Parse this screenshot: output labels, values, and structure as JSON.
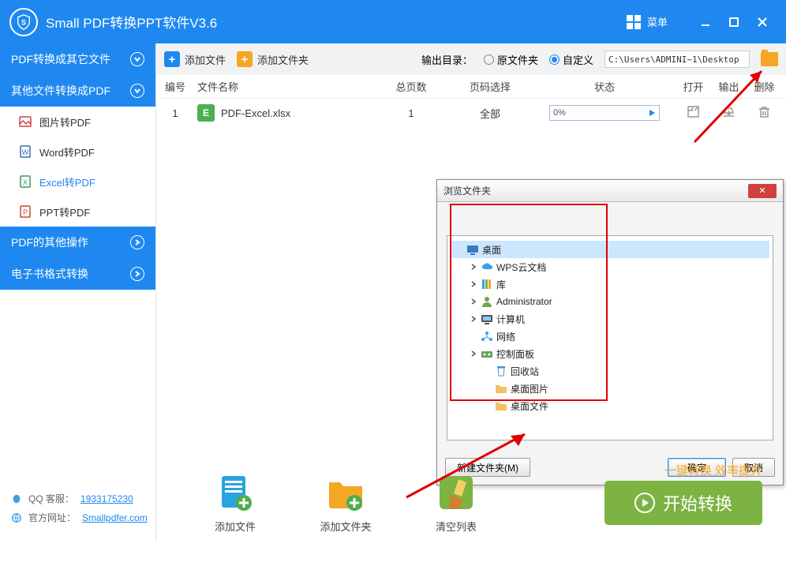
{
  "titlebar": {
    "title": "Small  PDF转换PPT软件V3.6",
    "menu": "菜单"
  },
  "sidebar": {
    "groups": [
      {
        "label": "PDF转换成其它文件"
      },
      {
        "label": "其他文件转换成PDF"
      }
    ],
    "items": [
      {
        "label": "图片转PDF"
      },
      {
        "label": "Word转PDF"
      },
      {
        "label": "Excel转PDF"
      },
      {
        "label": "PPT转PDF"
      }
    ],
    "groupsAfter": [
      {
        "label": "PDF的其他操作"
      },
      {
        "label": "电子书格式转换"
      }
    ],
    "footer": {
      "qq_label": "QQ 客服：",
      "qq_link": "1933175230",
      "site_label": "官方网址：",
      "site_link": "Smallpdfer.com"
    }
  },
  "toolbar": {
    "add_file": "添加文件",
    "add_folder": "添加文件夹",
    "out_label": "输出目录：",
    "radio_src": "原文件夹",
    "radio_custom": "自定义",
    "path": "C:\\Users\\ADMINI~1\\Desktop"
  },
  "table": {
    "headers": {
      "idx": "编号",
      "name": "文件名称",
      "pages": "总页数",
      "sel": "页码选择",
      "state": "状态",
      "open": "打开",
      "out": "输出",
      "del": "删除"
    },
    "row": {
      "idx": "1",
      "name": "PDF-Excel.xlsx",
      "pages": "1",
      "sel": "全部",
      "pct": "0%",
      "icon": "E"
    }
  },
  "bottom": {
    "add_file": "添加文件",
    "add_folder": "添加文件夹",
    "clear": "清空列表",
    "slogan": "一键转换  效率提升",
    "start": "开始转换"
  },
  "dialog": {
    "title": "浏览文件夹",
    "nodes": [
      {
        "label": "桌面",
        "indent": 0,
        "selected": true,
        "icon": "desktop",
        "arrow": false
      },
      {
        "label": "WPS云文档",
        "indent": 1,
        "icon": "cloud",
        "arrow": true
      },
      {
        "label": "库",
        "indent": 1,
        "icon": "library",
        "arrow": true
      },
      {
        "label": "Administrator",
        "indent": 1,
        "icon": "user",
        "arrow": true
      },
      {
        "label": "计算机",
        "indent": 1,
        "icon": "computer",
        "arrow": true
      },
      {
        "label": "网络",
        "indent": 1,
        "icon": "network",
        "arrow": false
      },
      {
        "label": "控制面板",
        "indent": 1,
        "icon": "control",
        "arrow": true
      },
      {
        "label": "回收站",
        "indent": 2,
        "icon": "recycle",
        "arrow": false
      },
      {
        "label": "桌面图片",
        "indent": 2,
        "icon": "folder",
        "arrow": false
      },
      {
        "label": "桌面文件",
        "indent": 2,
        "icon": "folder",
        "arrow": false
      }
    ],
    "new_folder": "新建文件夹(M)",
    "ok": "确定",
    "cancel": "取消"
  }
}
